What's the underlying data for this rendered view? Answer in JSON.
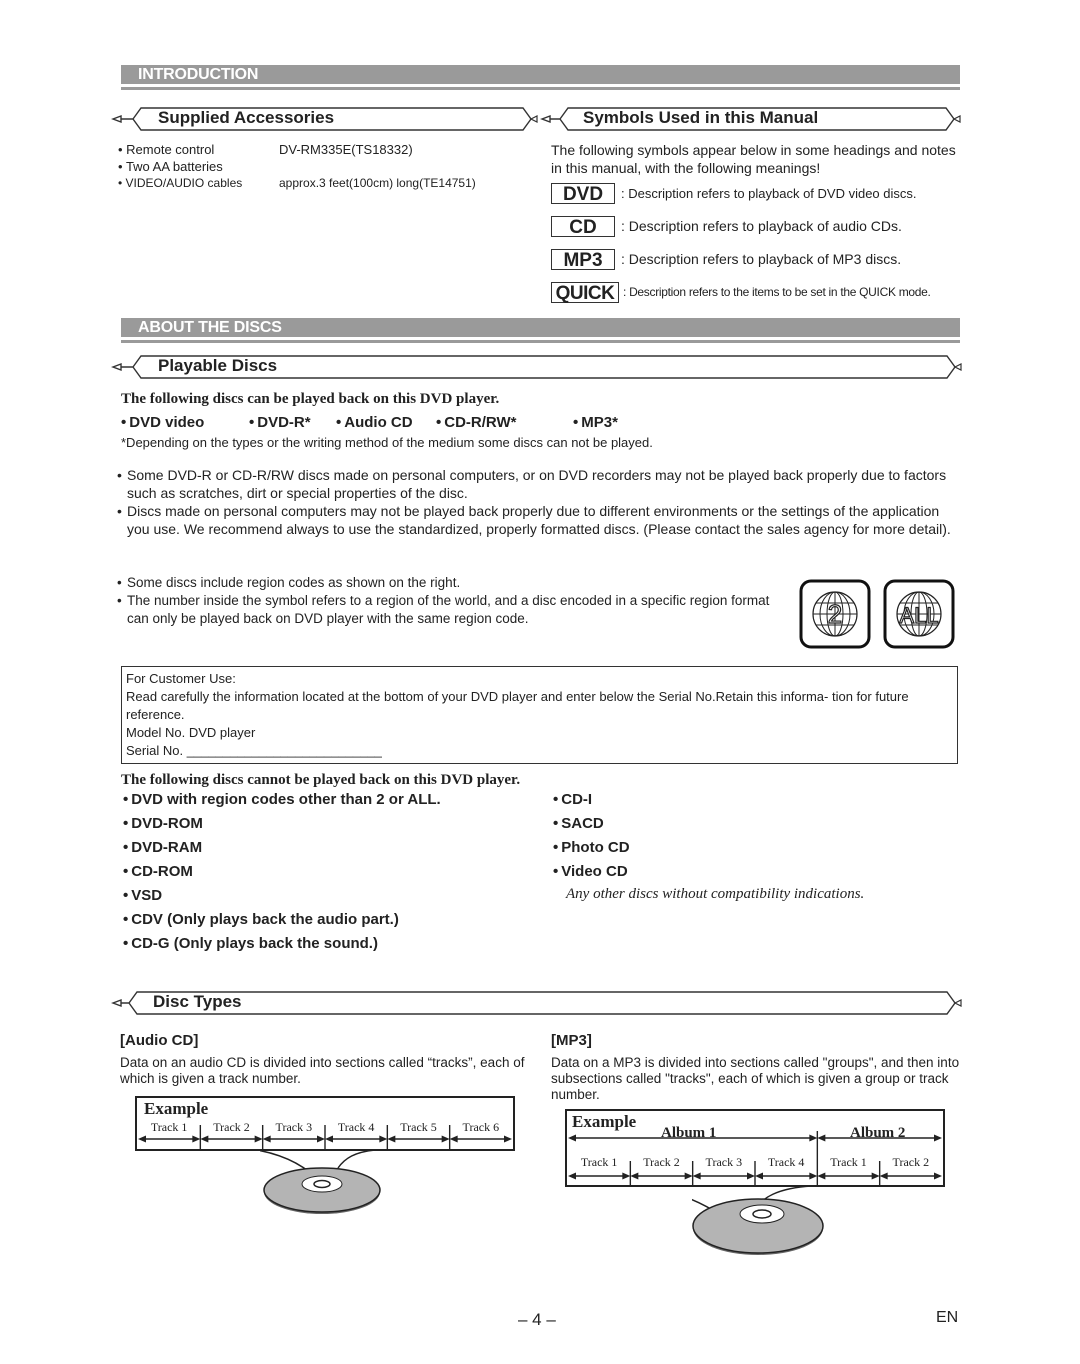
{
  "introduction": {
    "section_title": "INTRODUCTION",
    "supplied_accessories": {
      "heading": "Supplied Accessories",
      "items": [
        {
          "name": "Remote control",
          "detail": "DV-RM335E(TS18332)"
        },
        {
          "name": "Two AA batteries",
          "detail": ""
        },
        {
          "name": "VIDEO/AUDIO cables",
          "detail": "approx.3 feet(100cm) long(TE14751)"
        }
      ]
    },
    "symbols": {
      "heading": "Symbols Used in this Manual",
      "intro": "The following symbols appear below in some headings and notes in this manual, with the following meanings!",
      "items": [
        {
          "symbol": "DVD",
          "desc": ": Description refers to playback of DVD video discs."
        },
        {
          "symbol": "CD",
          "desc": ": Description refers to playback of audio CDs."
        },
        {
          "symbol": "MP3",
          "desc": ": Description refers to playback of MP3 discs."
        },
        {
          "symbol": "QUICK",
          "desc": ": Description refers to the items to be set in the QUICK mode."
        }
      ]
    }
  },
  "about_discs": {
    "section_title": "ABOUT THE DISCS",
    "playable": {
      "heading": "Playable Discs",
      "lead": "The following discs can be played back on this DVD player.",
      "discs": [
        "DVD video",
        "DVD-R*",
        "Audio CD",
        "CD-R/RW*",
        "MP3*"
      ],
      "footnote": "*Depending on the types or the writing method of the medium some discs can not be played.",
      "notes": [
        "Some DVD-R or CD-R/RW discs made on personal computers, or on DVD recorders may not be played back properly due to factors such as scratches, dirt or special properties of the disc.",
        "Discs made on personal computers may not be played back properly due to different environments or the settings of the application you use. We recommend always to use the standardized, properly formatted discs. (Please contact the sales agency for more detail)."
      ],
      "region_notes": [
        "Some discs include region codes as shown on the right.",
        "The number inside the symbol refers to a region of the world, and a disc encoded in a specific region format can only be played back on DVD player with the same region code."
      ],
      "region_icons": [
        "2",
        "ALL"
      ]
    },
    "customer_box": {
      "title": "For Customer Use:",
      "text": "Read carefully the information located at the bottom of your DVD player and enter below the Serial No.Retain this informa- tion for future reference.",
      "model": "Model No. DVD player",
      "serial": "Serial No. ___________________________"
    },
    "not_playable": {
      "lead": "The following discs cannot be played back on this DVD player.",
      "left": [
        "DVD with region codes other than 2 or ALL.",
        "DVD-ROM",
        "DVD-RAM",
        "CD-ROM",
        "VSD",
        "CDV (Only plays back the audio part.)",
        "CD-G (Only plays back the sound.)"
      ],
      "right": [
        "CD-I",
        "SACD",
        "Photo CD",
        "Video CD"
      ],
      "other": "Any other discs without compatibility indications."
    },
    "disc_types": {
      "heading": "Disc Types",
      "audio_cd": {
        "title": "[Audio CD]",
        "text": "Data on an audio CD is divided into sections called “tracks”, each of which is given a track number.",
        "example_title": "Example",
        "tracks": [
          "Track 1",
          "Track 2",
          "Track 3",
          "Track 4",
          "Track 5",
          "Track 6"
        ]
      },
      "mp3": {
        "title": "[MP3]",
        "text": "Data on a MP3 is divided into sections called \"groups\", and then into subsections called \"tracks\", each of which is given a group or track number.",
        "example_title": "Example",
        "albums": [
          {
            "label": "Album 1",
            "tracks": [
              "Track 1",
              "Track 2",
              "Track 3",
              "Track 4"
            ]
          },
          {
            "label": "Album 2",
            "tracks": [
              "Track 1",
              "Track 2"
            ]
          }
        ]
      }
    }
  },
  "footer": {
    "page_number": "– 4 –",
    "language": "EN"
  }
}
